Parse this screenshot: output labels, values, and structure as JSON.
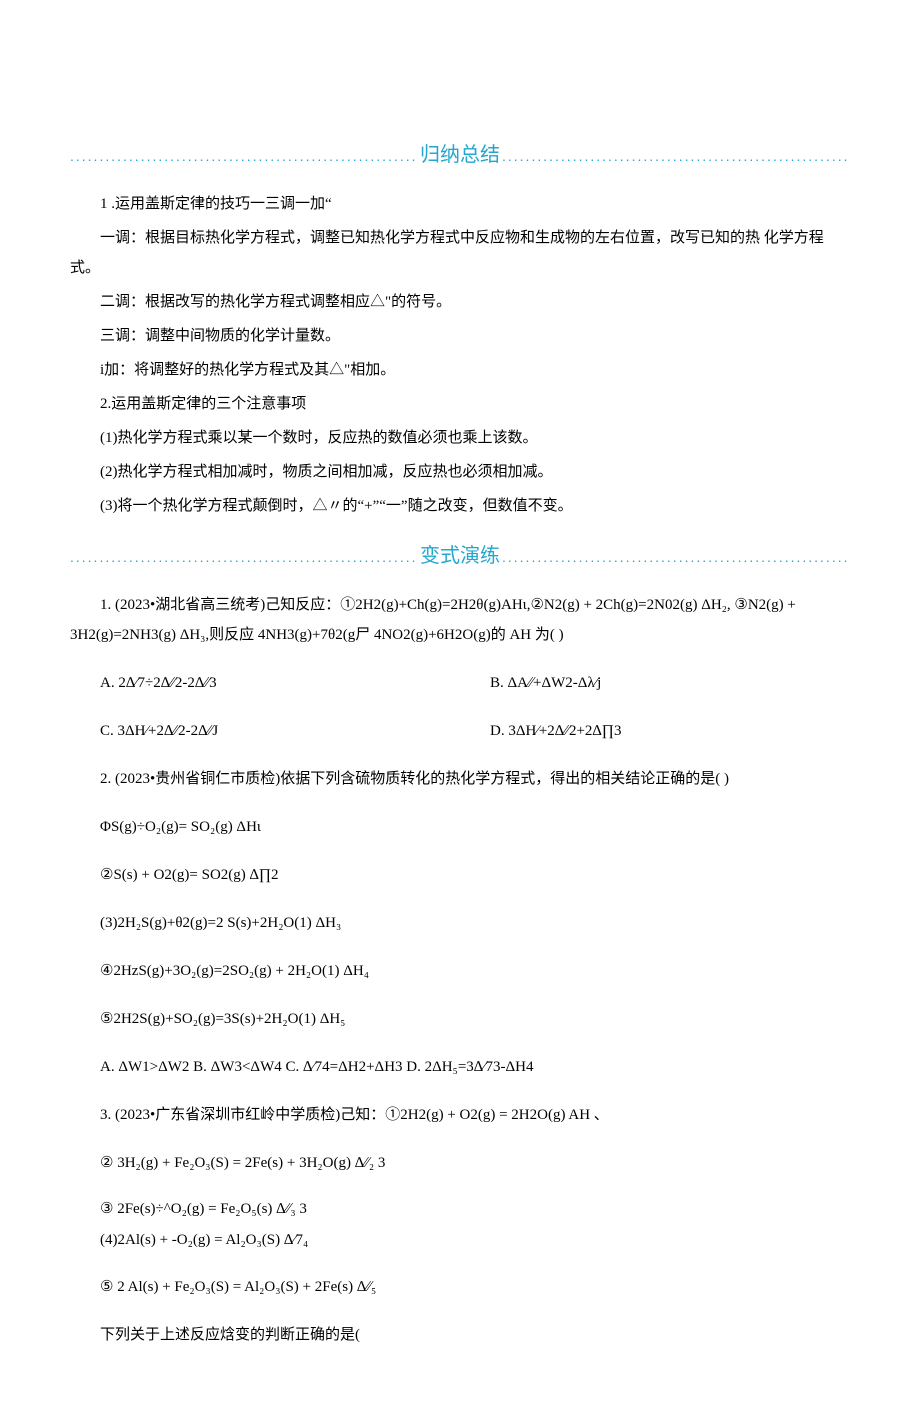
{
  "headers": {
    "summary": "归纳总结",
    "practice": "变式演练"
  },
  "summary": {
    "rule_title": "1 .运用盖斯定律的技巧一三调一加“",
    "step1": "一调：根据目标热化学方程式，调整已知热化学方程式中反应物和生成物的左右位置，改写已知的热 化学方程式。",
    "step2": "二调：根据改写的热化学方程式调整相应△\"的符号。",
    "step3": "三调：调整中间物质的化学计量数。",
    "step4": "i加：将调整好的热化学方程式及其△\"相加。",
    "note_title": "2.运用盖斯定律的三个注意事项",
    "note1": "(1)热化学方程式乘以某一个数时，反应热的数值必须也乘上该数。",
    "note2": "(2)热化学方程式相加减时，物质之间相加减，反应热也必须相加减。",
    "note3": "(3)将一个热化学方程式颠倒时，△〃的“+”“一”随之改变，但数值不变。"
  },
  "q1": {
    "stem": "1.   (2023•湖北省高三统考)己知反应：①2H2(g)+Ch(g)=2H2θ(g)AHι,②N2(g) + 2Ch(g)=2N02(g)         ΔH₂, ③N2(g) + 3H2(g)=2NH3(g) ΔH₃,则反应  4NH3(g)+7θ2(g尸  4NO2(g)+6H2O(g)的  AH 为(            )",
    "optA": "A. 2∆∕7÷2∆∕∕2-2∆∕∕3",
    "optB": "B. ΔA∕∕+ΔW2-Δλ∕j",
    "optC": "C. 3ΔH⁄+2∆∕∕2-2∆∕∕J",
    "optD": "D. 3ΔH⁄+2∆∕∕2+2∆∏3"
  },
  "q2": {
    "stem": "2.   (2023•贵州省铜仁市质检)依据下列含硫物质转化的热化学方程式，得出的相关结论正确的是(          )",
    "eq1": "ΦS(g)÷O₂(g)= SO₂(g) ΔHι",
    "eq2": "②S(s) + O2(g)= SO2(g)      ∆∏2",
    "eq3": "(3)2H₂S(g)+θ2(g)=2 S(s)+2H₂O(1) ΔH₃",
    "eq4": "④2HzS(g)+3O₂(g)=2SO₂(g) + 2H₂O(1)          ΔH₄",
    "eq5": "⑤2H2S(g)+SO₂(g)=3S(s)+2H₂O(1)           ΔH₅",
    "opts": "A. ΔW1>ΔW2 B. ΔW3<ΔW4 C. ∆∕74=ΔH2+ΔH3 D. 2ΔH₅=3∆∕73-ΔH4"
  },
  "q3": {
    "stem": "3.   (2023•广东省深圳市红岭中学质检)己知：①2H2(g) + O2(g) = 2H2O(g) AH 、",
    "eq2": "② 3H₂(g) + Fe₂O₃(S) = 2Fe(s) + 3H₂O(g) ∆∕∕₂ 3",
    "eq3": "③ 2Fe(s)÷^O₂(g) = Fe₂O₅(s) ∆∕∕₃ 3",
    "eq4": "(4)2Al(s) + -O₂(g) = Al₂O₃(S) ∆∕7₄",
    "eq5": "⑤ 2 Al(s) + Fe₂O₃(S) = Al₂O₃(S) + 2Fe(s) ∆∕∕₅",
    "tail": "下列关于上述反应焓变的判断正确的是("
  }
}
